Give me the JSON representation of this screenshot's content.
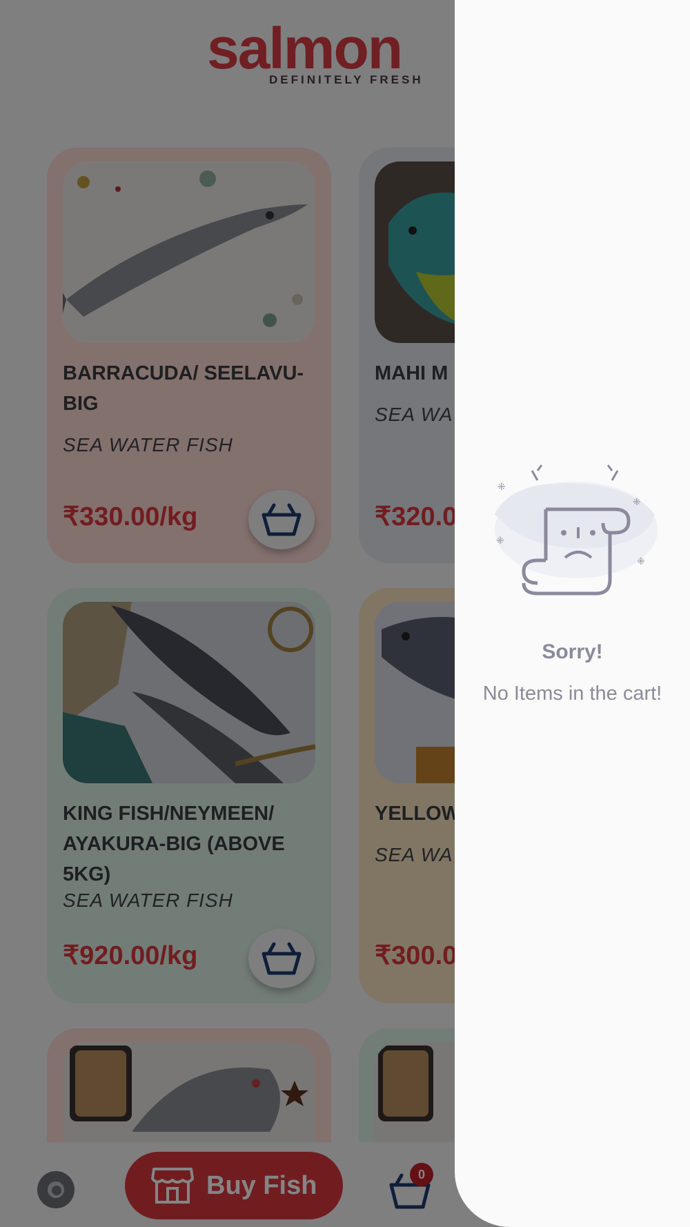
{
  "brand": {
    "name": "salmon",
    "tagline": "DEFINITELY FRESH",
    "color": "#d63c43"
  },
  "products": [
    {
      "name": "BARRACUDA/ SEELAVU-BIG",
      "category": "SEA WATER FISH",
      "price": "₹330.00/kg",
      "card_color": "#fbd8d4"
    },
    {
      "name": "MAHI M MOTHA",
      "category": "SEA WA",
      "price": "₹320.0",
      "card_color": "#e3e4ec"
    },
    {
      "name": "KING FISH/NEYMEEN/ AYAKURA-BIG (ABOVE 5KG)",
      "category": "SEA WATER FISH",
      "price": "₹920.00/kg",
      "card_color": "#dcefe6"
    },
    {
      "name": "YELLOW KERA-B",
      "category": "SEA WA",
      "price": "₹300.0",
      "card_color": "#f8e2c0"
    }
  ],
  "bottom_bar": {
    "buy_label": "Buy Fish",
    "cart_count": "0",
    "buy_icon": "store-icon",
    "cart_icon": "basket-icon"
  },
  "cart_drawer": {
    "title": "Sorry!",
    "message": "No Items in the cart!",
    "illustration": "sad-scroll-icon"
  }
}
